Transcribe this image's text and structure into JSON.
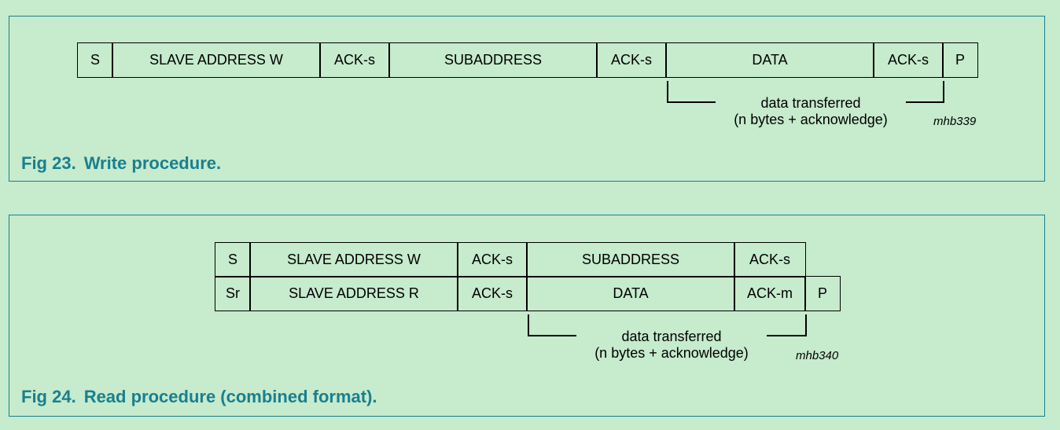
{
  "fig23": {
    "cells": [
      "S",
      "SLAVE ADDRESS W",
      "ACK-s",
      "SUBADDRESS",
      "ACK-s",
      "DATA",
      "ACK-s",
      "P"
    ],
    "bracket_line1": "data transferred",
    "bracket_line2": "(n bytes + acknowledge)",
    "ref": "mhb339",
    "caption_number": "Fig 23.",
    "caption_text": "Write procedure."
  },
  "fig24": {
    "row1": [
      "S",
      "SLAVE ADDRESS W",
      "ACK-s",
      "SUBADDRESS",
      "ACK-s"
    ],
    "row2": [
      "Sr",
      "SLAVE ADDRESS R",
      "ACK-s",
      "DATA",
      "ACK-m",
      "P"
    ],
    "bracket_line1": "data transferred",
    "bracket_line2": "(n bytes + acknowledge)",
    "ref": "mhb340",
    "caption_number": "Fig 24.",
    "caption_text": "Read procedure (combined format)."
  }
}
